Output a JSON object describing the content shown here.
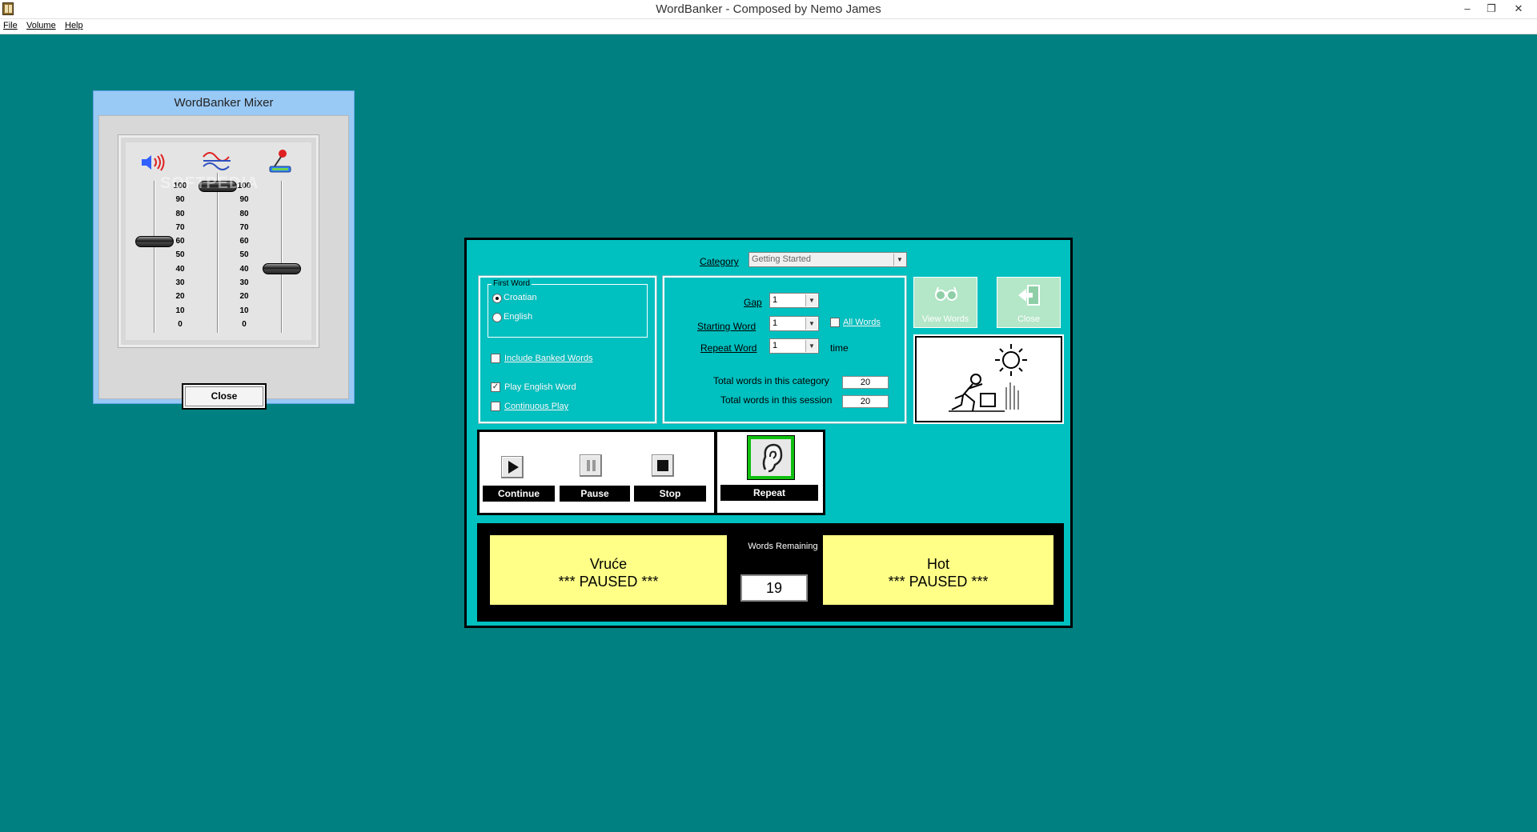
{
  "window": {
    "title": "WordBanker - Composed by Nemo James",
    "minimize_glyph": "–",
    "restore_glyph": "❐",
    "close_glyph": "✕"
  },
  "menu": {
    "file": "File",
    "volume": "Volume",
    "help": "Help"
  },
  "mixer": {
    "title": "WordBanker Mixer",
    "scale": [
      "100",
      "90",
      "80",
      "70",
      "60",
      "50",
      "40",
      "30",
      "20",
      "10",
      "0"
    ],
    "icons": [
      "speaker-icon",
      "wave-icon",
      "microphone-icon"
    ],
    "levels": {
      "volume": 60,
      "wave": 100,
      "microphone": 40
    },
    "close_label": "Close"
  },
  "main": {
    "category_label": "Category",
    "category_value": "Getting Started",
    "first_word_title": "First Word",
    "croatian": "Croatian",
    "english": "English",
    "first_word_selected": "Croatian",
    "include_banked": "Include Banked Words",
    "include_banked_checked": false,
    "play_english": "Play English Word",
    "play_english_checked": true,
    "continuous": "Continuous Play",
    "continuous_checked": false,
    "gap_label": "Gap",
    "gap_value": "1",
    "starting_label": "Starting Word",
    "starting_value": "1",
    "all_words": "All Words",
    "all_words_checked": false,
    "repeat_label": "Repeat Word",
    "repeat_value": "1",
    "time_label": "time",
    "total_category_label": "Total words in this category",
    "total_category_value": "20",
    "total_session_label": "Total words in this session",
    "total_session_value": "20",
    "view_words": "View Words",
    "close": "Close",
    "check_glyph": "✓",
    "arrow_glyph": "▼"
  },
  "controls": {
    "continue": "Continue",
    "pause": "Pause",
    "stop": "Stop",
    "repeat": "Repeat"
  },
  "display": {
    "croatian_word": "Vruće",
    "croatian_status": "*** PAUSED ***",
    "words_remaining_label": "Words Remaining",
    "words_remaining": "19",
    "english_word": "Hot",
    "english_status": "*** PAUSED ***"
  }
}
